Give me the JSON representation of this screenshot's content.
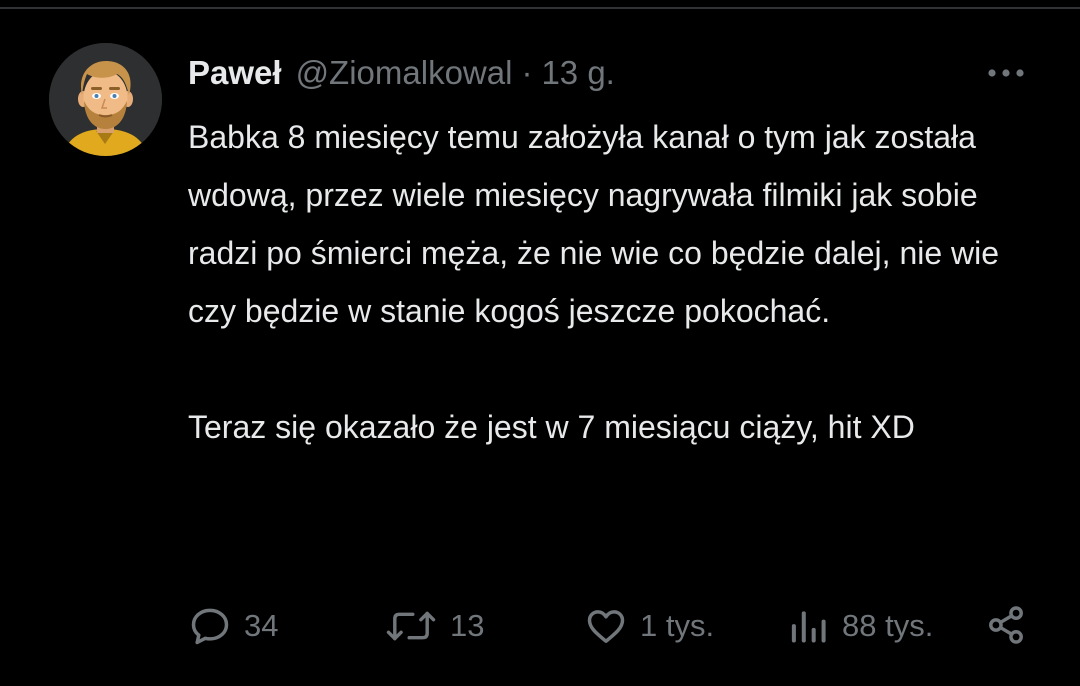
{
  "tweet": {
    "author": {
      "name": "Paweł",
      "handle": "@Ziomalkowal",
      "separator": "·",
      "time": "13 g."
    },
    "text": {
      "paragraph1": "Babka 8 miesięcy temu założyła kanał o tym jak została wdową, przez wiele miesięcy nagrywała filmiki jak sobie radzi po śmierci męża, że nie wie co będzie dalej, nie wie czy będzie w stanie kogoś jeszcze pokochać.",
      "paragraph2": "Teraz się okazało że jest w 7 miesiącu ciąży, hit XD"
    },
    "stats": {
      "replies": "34",
      "retweets": "13",
      "likes": "1 tys.",
      "views": "88 tys."
    }
  },
  "icons": {
    "more": "more-horizontal-icon",
    "reply": "speech-bubble-icon",
    "retweet": "retweet-icon",
    "like": "heart-icon",
    "views": "bar-chart-icon",
    "share": "share-icon"
  },
  "colors": {
    "background": "#000000",
    "primary_text": "#e7e9ea",
    "secondary_text": "#71767b",
    "divider": "#2f3336"
  }
}
